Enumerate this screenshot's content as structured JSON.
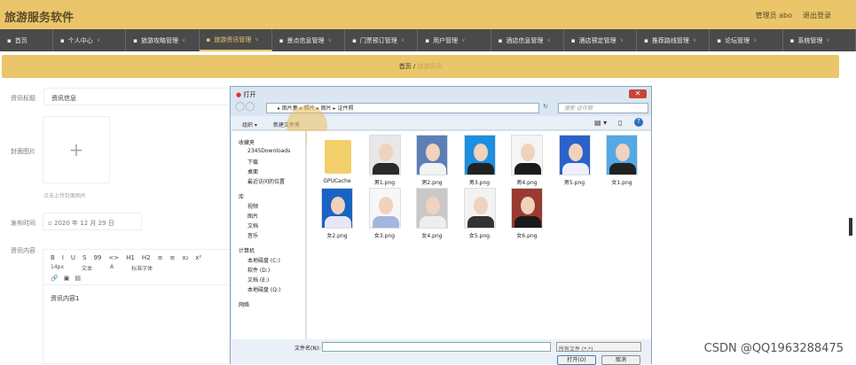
{
  "header": {
    "title": "旅游服务软件",
    "user": "管理员 abo",
    "logout": "退出登录"
  },
  "nav": [
    {
      "icon": "home-icon",
      "label": "首页"
    },
    {
      "icon": "user-icon",
      "label": "个人中心"
    },
    {
      "icon": "circle-icon",
      "label": "旅游攻略管理"
    },
    {
      "icon": "doc-icon",
      "label": "旅游资讯管理",
      "active": true
    },
    {
      "icon": "list-icon",
      "label": "景点信息管理"
    },
    {
      "icon": "ticket-icon",
      "label": "门票预订管理"
    },
    {
      "icon": "user-icon",
      "label": "用户管理"
    },
    {
      "icon": "hotel-icon",
      "label": "酒店信息管理"
    },
    {
      "icon": "bracket-icon",
      "label": "酒店预定管理"
    },
    {
      "icon": "user-icon",
      "label": "推荐路线管理"
    },
    {
      "icon": "user-icon",
      "label": "论坛管理"
    },
    {
      "icon": "grid-icon",
      "label": "系统管理"
    }
  ],
  "breadcrumb": {
    "home": "首页",
    "sep": "/",
    "current": "旅游资讯"
  },
  "form": {
    "title_label": "资讯标题",
    "title_value": "资讯信息",
    "cover_label": "封面图片",
    "cover_hint": "点击上传封面图片",
    "date_label": "发布时间",
    "date_value": "2020 年 12 月 29 日",
    "content_label": "资讯内容",
    "content_value": "资讯内容1",
    "toolbar1": [
      "B",
      "I",
      "U",
      "S",
      "99",
      "<>",
      "H1",
      "H2",
      "≡",
      "≡",
      "x₂",
      "x²"
    ],
    "toolbar2": {
      "size": "14px",
      "type": "文本",
      "font": "标准字体"
    }
  },
  "dialog": {
    "title": "打开",
    "path": [
      "图片集",
      "照片",
      "图片",
      "证件照"
    ],
    "search_placeholder": "搜索 证件照",
    "organize": "组织 ▾",
    "new_folder": "新建文件夹",
    "sidebar": [
      {
        "g": true,
        "label": "收藏夹"
      },
      {
        "label": "2345Downloads"
      },
      {
        "label": "下载"
      },
      {
        "label": "桌面"
      },
      {
        "label": "最近访问的位置"
      },
      {
        "g": true,
        "label": "库"
      },
      {
        "label": "视频"
      },
      {
        "label": "图片"
      },
      {
        "label": "文档"
      },
      {
        "label": "音乐"
      },
      {
        "g": true,
        "label": "计算机"
      },
      {
        "label": "本地磁盘 (C:)"
      },
      {
        "label": "软件 (D:)"
      },
      {
        "label": "文档 (E:)"
      },
      {
        "label": "本地磁盘 (Q:)"
      },
      {
        "g": true,
        "label": "网络"
      }
    ],
    "files": [
      {
        "name": "GPUCache",
        "folder": true
      },
      {
        "name": "男1.png",
        "bg": "#e8e8ea",
        "c": "#2a2a2a"
      },
      {
        "name": "男2.png",
        "bg": "#5d7fb8",
        "c": "#f3f3f3"
      },
      {
        "name": "男3.png",
        "bg": "#1d8fe0",
        "c": "#222"
      },
      {
        "name": "男4.png",
        "bg": "#f5f5f5",
        "c": "#1a1a1a"
      },
      {
        "name": "男5.png",
        "bg": "#2a62c9",
        "c": "#eef"
      },
      {
        "name": "女1.png",
        "bg": "#52a9e6",
        "c": "#222"
      },
      {
        "name": "女2.png",
        "bg": "#1a63c4",
        "c": "#e6e6f5"
      },
      {
        "name": "女3.png",
        "bg": "#f7f7f7",
        "c": "#a3b6df"
      },
      {
        "name": "女4.png",
        "bg": "#c8c8c8",
        "c": "#eee"
      },
      {
        "name": "女5.png",
        "bg": "#f2f2f2",
        "c": "#333"
      },
      {
        "name": "女6.png",
        "bg": "#9b3a30",
        "c": "#1a1a1a"
      }
    ],
    "filename_label": "文件名(N):",
    "filter": "所有文件 (*.*)",
    "open": "打开(O)",
    "cancel": "取消"
  },
  "watermark": "CSDN @QQ1963288475"
}
